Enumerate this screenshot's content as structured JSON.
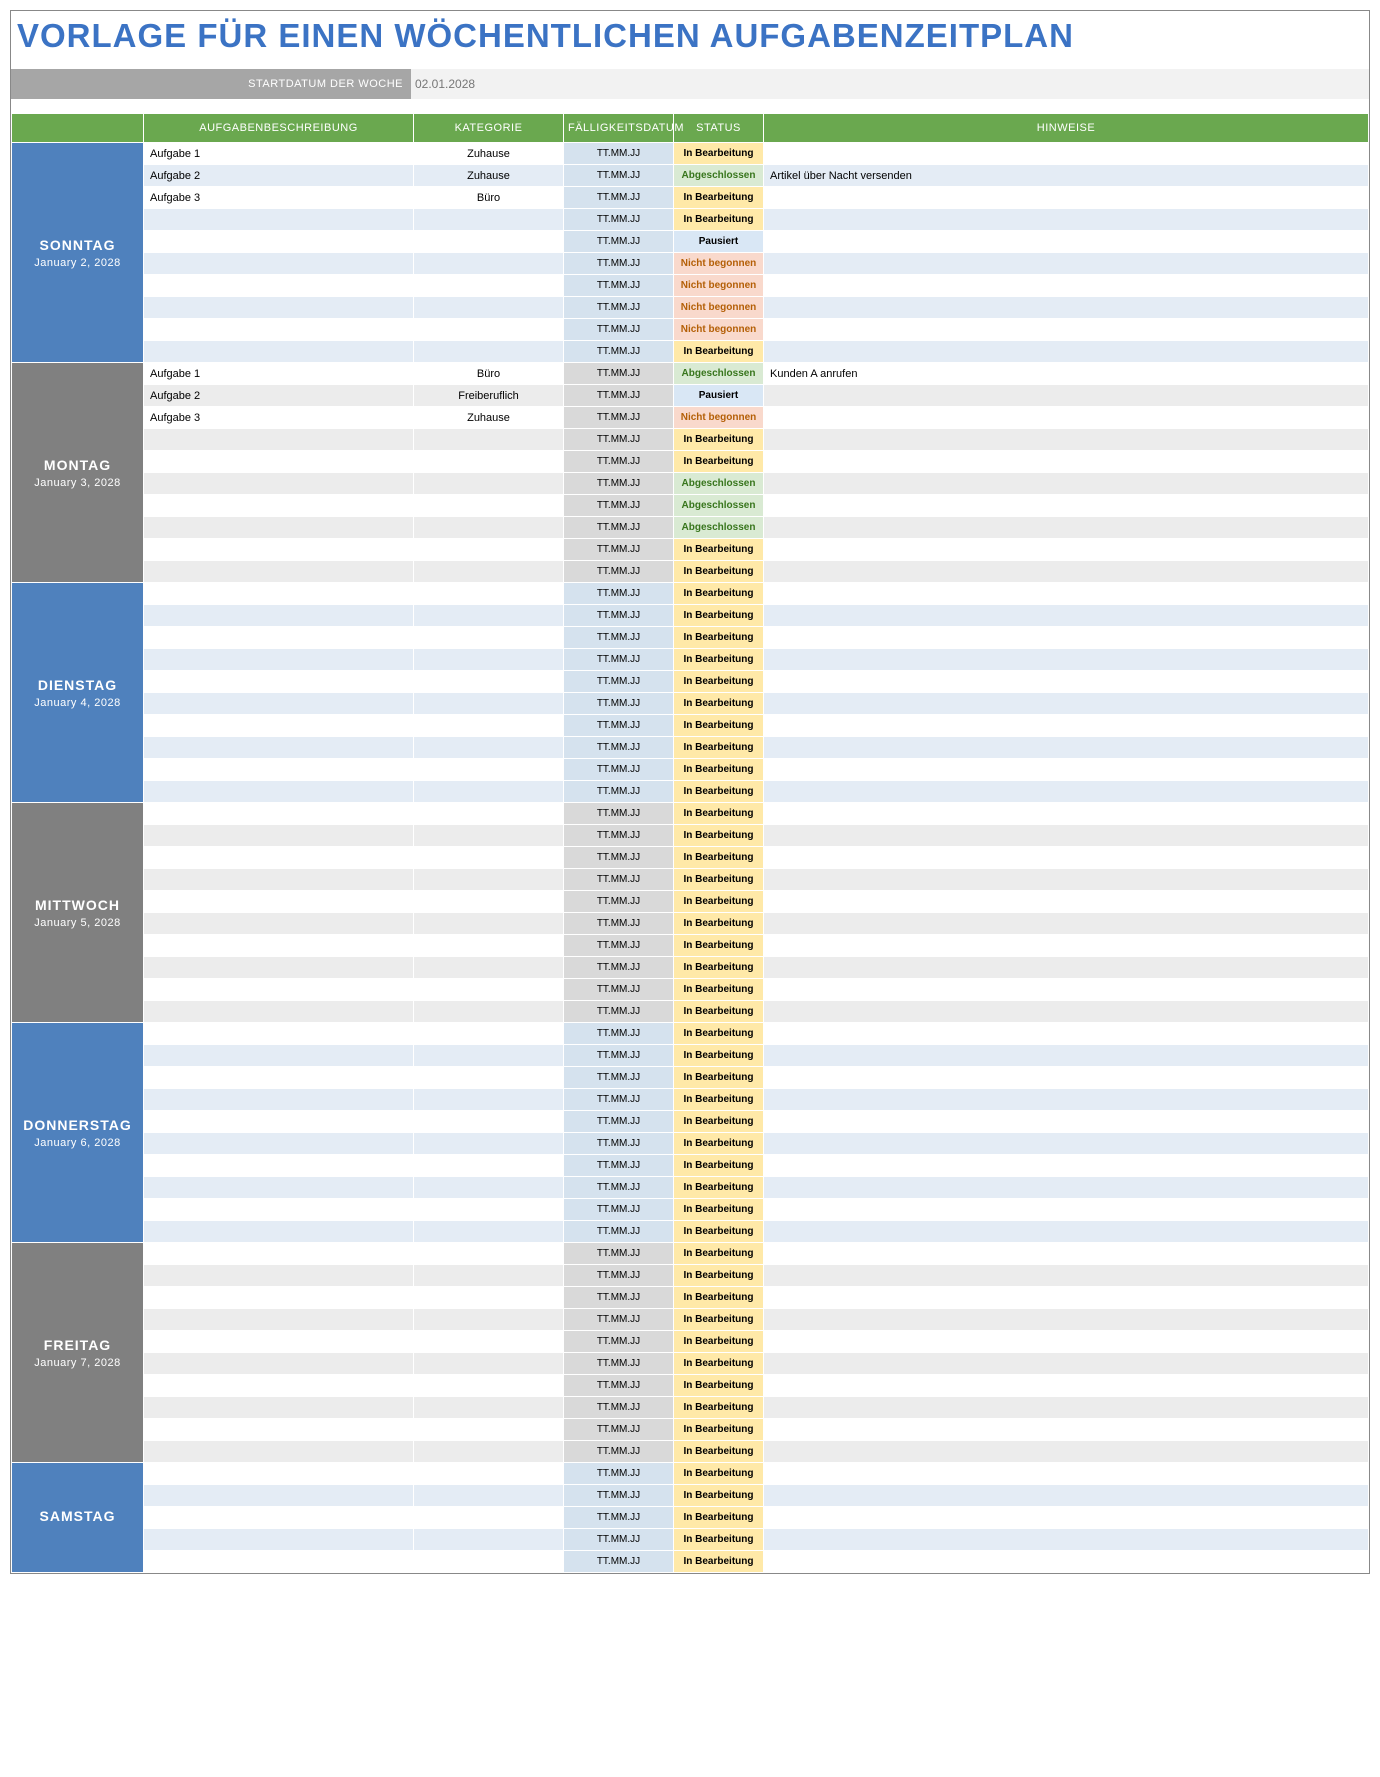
{
  "title": "VORLAGE FÜR EINEN WÖCHENTLICHEN AUFGABENZEITPLAN",
  "start_label": "STARTDATUM DER WOCHE",
  "start_value": "02.01.2028",
  "columns": {
    "description": "AUFGABENBESCHREIBUNG",
    "category": "KATEGORIE",
    "due": "FÄLLIGKEITSDATUM",
    "status": "STATUS",
    "notes": "HINWEISE"
  },
  "due_placeholder": "TT.MM.JJ",
  "status_labels": {
    "in_progress": "In Bearbeitung",
    "done": "Abgeschlossen",
    "paused": "Pausiert",
    "not_started": "Nicht begonnen"
  },
  "days": [
    {
      "name": "SONNTAG",
      "date": "January 2, 2028",
      "color": "blue",
      "rows": [
        {
          "desc": "Aufgabe 1",
          "cat": "Zuhause",
          "status": "in_progress",
          "notes": ""
        },
        {
          "desc": "Aufgabe 2",
          "cat": "Zuhause",
          "status": "done",
          "notes": "Artikel über Nacht versenden"
        },
        {
          "desc": "Aufgabe 3",
          "cat": "Büro",
          "status": "in_progress",
          "notes": ""
        },
        {
          "desc": "",
          "cat": "",
          "status": "in_progress",
          "notes": ""
        },
        {
          "desc": "",
          "cat": "",
          "status": "paused",
          "notes": ""
        },
        {
          "desc": "",
          "cat": "",
          "status": "not_started",
          "notes": ""
        },
        {
          "desc": "",
          "cat": "",
          "status": "not_started",
          "notes": ""
        },
        {
          "desc": "",
          "cat": "",
          "status": "not_started",
          "notes": ""
        },
        {
          "desc": "",
          "cat": "",
          "status": "not_started",
          "notes": ""
        },
        {
          "desc": "",
          "cat": "",
          "status": "in_progress",
          "notes": ""
        }
      ]
    },
    {
      "name": "MONTAG",
      "date": "January 3, 2028",
      "color": "grey",
      "rows": [
        {
          "desc": "Aufgabe 1",
          "cat": "Büro",
          "status": "done",
          "notes": "Kunden A anrufen"
        },
        {
          "desc": "Aufgabe 2",
          "cat": "Freiberuflich",
          "status": "paused",
          "notes": ""
        },
        {
          "desc": "Aufgabe 3",
          "cat": "Zuhause",
          "status": "not_started",
          "notes": ""
        },
        {
          "desc": "",
          "cat": "",
          "status": "in_progress",
          "notes": ""
        },
        {
          "desc": "",
          "cat": "",
          "status": "in_progress",
          "notes": ""
        },
        {
          "desc": "",
          "cat": "",
          "status": "done",
          "notes": ""
        },
        {
          "desc": "",
          "cat": "",
          "status": "done",
          "notes": ""
        },
        {
          "desc": "",
          "cat": "",
          "status": "done",
          "notes": ""
        },
        {
          "desc": "",
          "cat": "",
          "status": "in_progress",
          "notes": ""
        },
        {
          "desc": "",
          "cat": "",
          "status": "in_progress",
          "notes": ""
        }
      ]
    },
    {
      "name": "DIENSTAG",
      "date": "January 4, 2028",
      "color": "blue",
      "rows": [
        {
          "desc": "",
          "cat": "",
          "status": "in_progress",
          "notes": ""
        },
        {
          "desc": "",
          "cat": "",
          "status": "in_progress",
          "notes": ""
        },
        {
          "desc": "",
          "cat": "",
          "status": "in_progress",
          "notes": ""
        },
        {
          "desc": "",
          "cat": "",
          "status": "in_progress",
          "notes": ""
        },
        {
          "desc": "",
          "cat": "",
          "status": "in_progress",
          "notes": ""
        },
        {
          "desc": "",
          "cat": "",
          "status": "in_progress",
          "notes": ""
        },
        {
          "desc": "",
          "cat": "",
          "status": "in_progress",
          "notes": ""
        },
        {
          "desc": "",
          "cat": "",
          "status": "in_progress",
          "notes": ""
        },
        {
          "desc": "",
          "cat": "",
          "status": "in_progress",
          "notes": ""
        },
        {
          "desc": "",
          "cat": "",
          "status": "in_progress",
          "notes": ""
        }
      ]
    },
    {
      "name": "MITTWOCH",
      "date": "January 5, 2028",
      "color": "grey",
      "rows": [
        {
          "desc": "",
          "cat": "",
          "status": "in_progress",
          "notes": ""
        },
        {
          "desc": "",
          "cat": "",
          "status": "in_progress",
          "notes": ""
        },
        {
          "desc": "",
          "cat": "",
          "status": "in_progress",
          "notes": ""
        },
        {
          "desc": "",
          "cat": "",
          "status": "in_progress",
          "notes": ""
        },
        {
          "desc": "",
          "cat": "",
          "status": "in_progress",
          "notes": ""
        },
        {
          "desc": "",
          "cat": "",
          "status": "in_progress",
          "notes": ""
        },
        {
          "desc": "",
          "cat": "",
          "status": "in_progress",
          "notes": ""
        },
        {
          "desc": "",
          "cat": "",
          "status": "in_progress",
          "notes": ""
        },
        {
          "desc": "",
          "cat": "",
          "status": "in_progress",
          "notes": ""
        },
        {
          "desc": "",
          "cat": "",
          "status": "in_progress",
          "notes": ""
        }
      ]
    },
    {
      "name": "DONNERSTAG",
      "date": "January 6, 2028",
      "color": "blue",
      "rows": [
        {
          "desc": "",
          "cat": "",
          "status": "in_progress",
          "notes": ""
        },
        {
          "desc": "",
          "cat": "",
          "status": "in_progress",
          "notes": ""
        },
        {
          "desc": "",
          "cat": "",
          "status": "in_progress",
          "notes": ""
        },
        {
          "desc": "",
          "cat": "",
          "status": "in_progress",
          "notes": ""
        },
        {
          "desc": "",
          "cat": "",
          "status": "in_progress",
          "notes": ""
        },
        {
          "desc": "",
          "cat": "",
          "status": "in_progress",
          "notes": ""
        },
        {
          "desc": "",
          "cat": "",
          "status": "in_progress",
          "notes": ""
        },
        {
          "desc": "",
          "cat": "",
          "status": "in_progress",
          "notes": ""
        },
        {
          "desc": "",
          "cat": "",
          "status": "in_progress",
          "notes": ""
        },
        {
          "desc": "",
          "cat": "",
          "status": "in_progress",
          "notes": ""
        }
      ]
    },
    {
      "name": "FREITAG",
      "date": "January 7, 2028",
      "color": "grey",
      "rows": [
        {
          "desc": "",
          "cat": "",
          "status": "in_progress",
          "notes": ""
        },
        {
          "desc": "",
          "cat": "",
          "status": "in_progress",
          "notes": ""
        },
        {
          "desc": "",
          "cat": "",
          "status": "in_progress",
          "notes": ""
        },
        {
          "desc": "",
          "cat": "",
          "status": "in_progress",
          "notes": ""
        },
        {
          "desc": "",
          "cat": "",
          "status": "in_progress",
          "notes": ""
        },
        {
          "desc": "",
          "cat": "",
          "status": "in_progress",
          "notes": ""
        },
        {
          "desc": "",
          "cat": "",
          "status": "in_progress",
          "notes": ""
        },
        {
          "desc": "",
          "cat": "",
          "status": "in_progress",
          "notes": ""
        },
        {
          "desc": "",
          "cat": "",
          "status": "in_progress",
          "notes": ""
        },
        {
          "desc": "",
          "cat": "",
          "status": "in_progress",
          "notes": ""
        }
      ]
    },
    {
      "name": "SAMSTAG",
      "date": "",
      "color": "blue",
      "rows": [
        {
          "desc": "",
          "cat": "",
          "status": "in_progress",
          "notes": ""
        },
        {
          "desc": "",
          "cat": "",
          "status": "in_progress",
          "notes": ""
        },
        {
          "desc": "",
          "cat": "",
          "status": "in_progress",
          "notes": ""
        },
        {
          "desc": "",
          "cat": "",
          "status": "in_progress",
          "notes": ""
        },
        {
          "desc": "",
          "cat": "",
          "status": "in_progress",
          "notes": ""
        }
      ]
    }
  ]
}
